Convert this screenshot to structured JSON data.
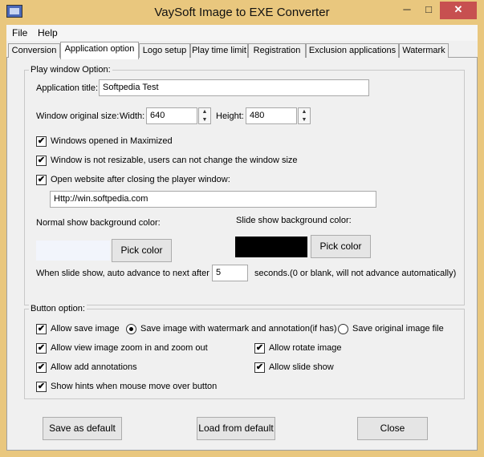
{
  "window": {
    "title": "VaySoft Image to EXE Converter",
    "minimize": "─",
    "maximize": "□",
    "close": "✕"
  },
  "menu": {
    "file": "File",
    "help": "Help"
  },
  "tabs": [
    "Conversion",
    "Application option",
    "Logo setup",
    "Play time limit",
    "Registration",
    "Exclusion applications",
    "Watermark"
  ],
  "play_window": {
    "group_label": "Play window Option:",
    "app_title_label": "Application title:",
    "app_title_value": "Softpedia Test",
    "size_label": "Window original size:",
    "width_label": "Width:",
    "width_value": "640",
    "height_label": "Height:",
    "height_value": "480",
    "maximized_label": "Windows opened in Maximized",
    "not_resizable_label": "Window is not resizable, users can not change the window size",
    "open_website_label": "Open website after closing the player window:",
    "website_value": "Http://win.softpedia.com",
    "normal_bg_label": "Normal show background color:",
    "slide_bg_label": "Slide show background color:",
    "pick_color_label": "Pick color",
    "normal_bg_color": "#f2f5fc",
    "slide_bg_color": "#000000",
    "advance_label": "When slide show, auto advance to next after",
    "advance_value": "5",
    "advance_suffix": "seconds.(0 or blank, will not advance automatically)"
  },
  "button_option": {
    "group_label": "Button option:",
    "allow_save": "Allow save image",
    "save_with_watermark": "Save image with watermark and annotation(if has)",
    "save_original": "Save original image file",
    "allow_zoom": "Allow view image zoom in and zoom out",
    "allow_rotate": "Allow rotate image",
    "allow_annotations": "Allow add annotations",
    "allow_slideshow": "Allow slide show",
    "show_hints": "Show hints when mouse move over button"
  },
  "footer": {
    "save_default": "Save as default",
    "load_default": "Load from default",
    "close": "Close"
  },
  "check_mark": "✔"
}
